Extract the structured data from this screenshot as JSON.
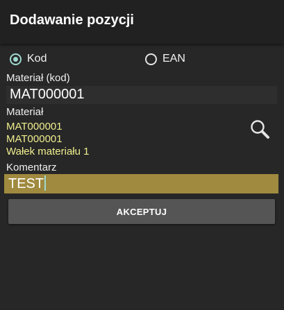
{
  "header": {
    "title": "Dodawanie pozycji"
  },
  "mode": {
    "options": [
      {
        "label": "Kod",
        "selected": true
      },
      {
        "label": "EAN",
        "selected": false
      }
    ]
  },
  "material_code": {
    "label": "Materiał (kod)",
    "value": "MAT000001"
  },
  "material": {
    "label": "Materiał",
    "lines": [
      "MAT000001",
      "MAT000001",
      "Wałek materiału 1"
    ],
    "search_icon": "search-icon"
  },
  "comment": {
    "label": "Komentarz",
    "value": "TEST"
  },
  "actions": {
    "accept_label": "AKCEPTUJ"
  },
  "colors": {
    "background": "#272727",
    "titlebar": "#212121",
    "accent": "#9fd9cf",
    "material_text": "#f0ee8e",
    "comment_field": "#a08a3f",
    "button": "#555555"
  }
}
